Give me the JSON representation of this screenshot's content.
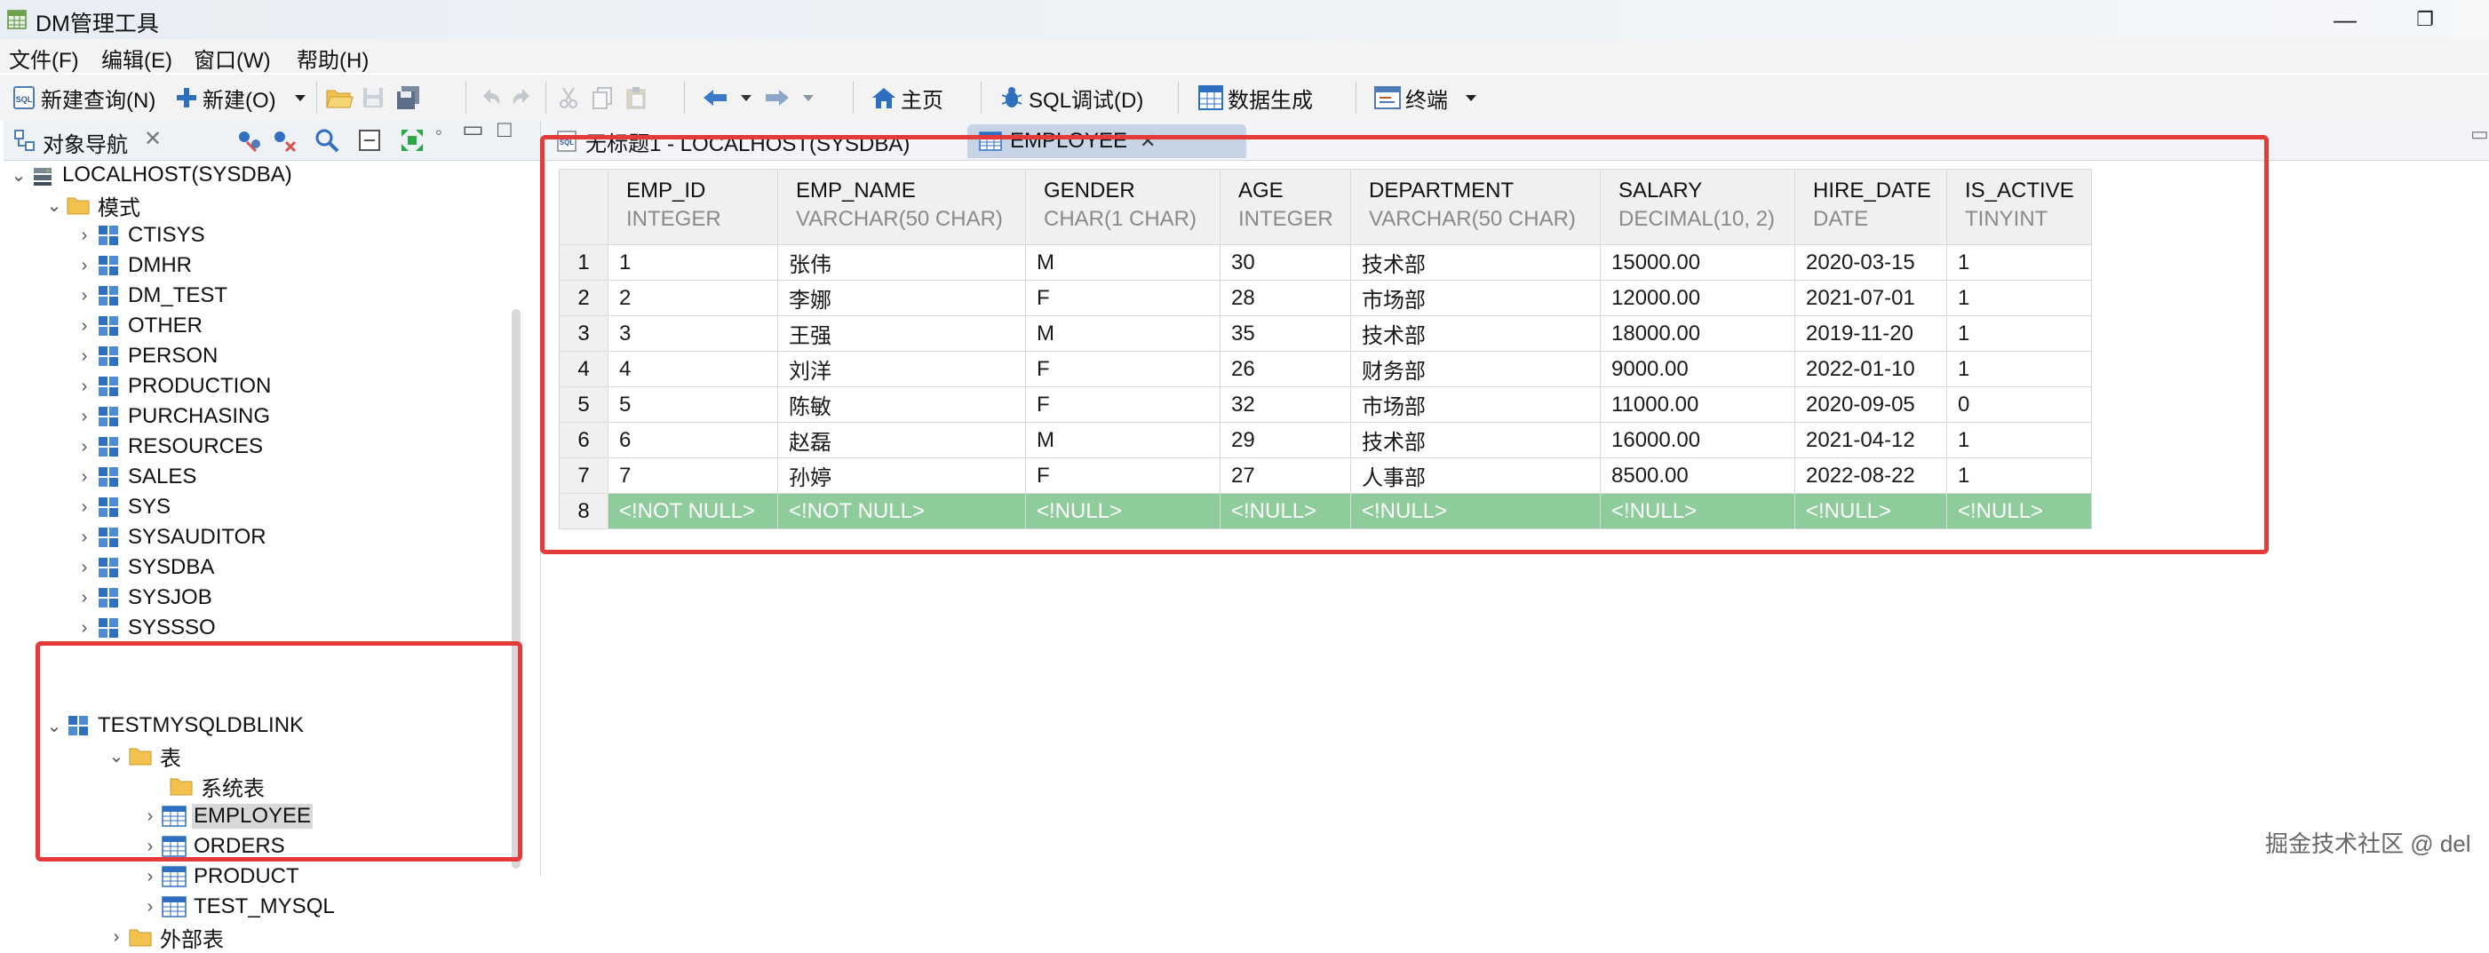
{
  "window": {
    "title": "DM管理工具",
    "minimize": "—",
    "maximize": "❐"
  },
  "menu": [
    "文件(F)",
    "编辑(E)",
    "窗口(W)",
    "帮助(H)"
  ],
  "toolbar": {
    "new_query": "新建查询(N)",
    "new": "新建(O)",
    "home": "主页",
    "sql_debug": "SQL调试(D)",
    "data_gen": "数据生成",
    "terminal": "终端"
  },
  "navigator": {
    "title": "对象导航",
    "close": "✕",
    "root": "LOCALHOST(SYSDBA)",
    "schema_folder": "模式",
    "schemas": [
      "CTISYS",
      "DMHR",
      "DM_TEST",
      "OTHER",
      "PERSON",
      "PRODUCTION",
      "PURCHASING",
      "RESOURCES",
      "SALES",
      "SYS",
      "SYSAUDITOR",
      "SYSDBA",
      "SYSJOB",
      "SYSSSO"
    ],
    "expanded_schema": "TESTMYSQLDBLINK",
    "table_folder": "表",
    "system_tables": "系统表",
    "tables": [
      "EMPLOYEE",
      "ORDERS",
      "PRODUCT",
      "TEST_MYSQL"
    ],
    "selected_table": "EMPLOYEE",
    "external_tables": "外部表"
  },
  "tabs": [
    {
      "label": "无标题1 - LOCALHOST(SYSDBA)"
    },
    {
      "label": "EMPLOYEE",
      "close": "✕"
    }
  ],
  "grid": {
    "columns": [
      {
        "name": "EMP_ID",
        "type": "INTEGER"
      },
      {
        "name": "EMP_NAME",
        "type": "VARCHAR(50 CHAR)"
      },
      {
        "name": "GENDER",
        "type": "CHAR(1 CHAR)"
      },
      {
        "name": "AGE",
        "type": "INTEGER"
      },
      {
        "name": "DEPARTMENT",
        "type": "VARCHAR(50 CHAR)"
      },
      {
        "name": "SALARY",
        "type": "DECIMAL(10, 2)"
      },
      {
        "name": "HIRE_DATE",
        "type": "DATE"
      },
      {
        "name": "IS_ACTIVE",
        "type": "TINYINT"
      }
    ],
    "rows": [
      [
        "1",
        "1",
        "张伟",
        "M",
        "30",
        "技术部",
        "15000.00",
        "2020-03-15",
        "1"
      ],
      [
        "2",
        "2",
        "李娜",
        "F",
        "28",
        "市场部",
        "12000.00",
        "2021-07-01",
        "1"
      ],
      [
        "3",
        "3",
        "王强",
        "M",
        "35",
        "技术部",
        "18000.00",
        "2019-11-20",
        "1"
      ],
      [
        "4",
        "4",
        "刘洋",
        "F",
        "26",
        "财务部",
        "9000.00",
        "2022-01-10",
        "1"
      ],
      [
        "5",
        "5",
        "陈敏",
        "F",
        "32",
        "市场部",
        "11000.00",
        "2020-09-05",
        "0"
      ],
      [
        "6",
        "6",
        "赵磊",
        "M",
        "29",
        "技术部",
        "16000.00",
        "2021-04-12",
        "1"
      ],
      [
        "7",
        "7",
        "孙婷",
        "F",
        "27",
        "人事部",
        "8500.00",
        "2022-08-22",
        "1"
      ]
    ],
    "new_row": [
      "8",
      "<!NOT NULL>",
      "<!NOT NULL>",
      "<!NULL>",
      "<!NULL>",
      "<!NULL>",
      "<!NULL>",
      "<!NULL>",
      "<!NULL>"
    ]
  },
  "watermark": "掘金技术社区 @ del",
  "colors": {
    "highlight": "#e53a3a",
    "new_row": "#8fcc9c",
    "active_tab": "#c7d4e6"
  }
}
